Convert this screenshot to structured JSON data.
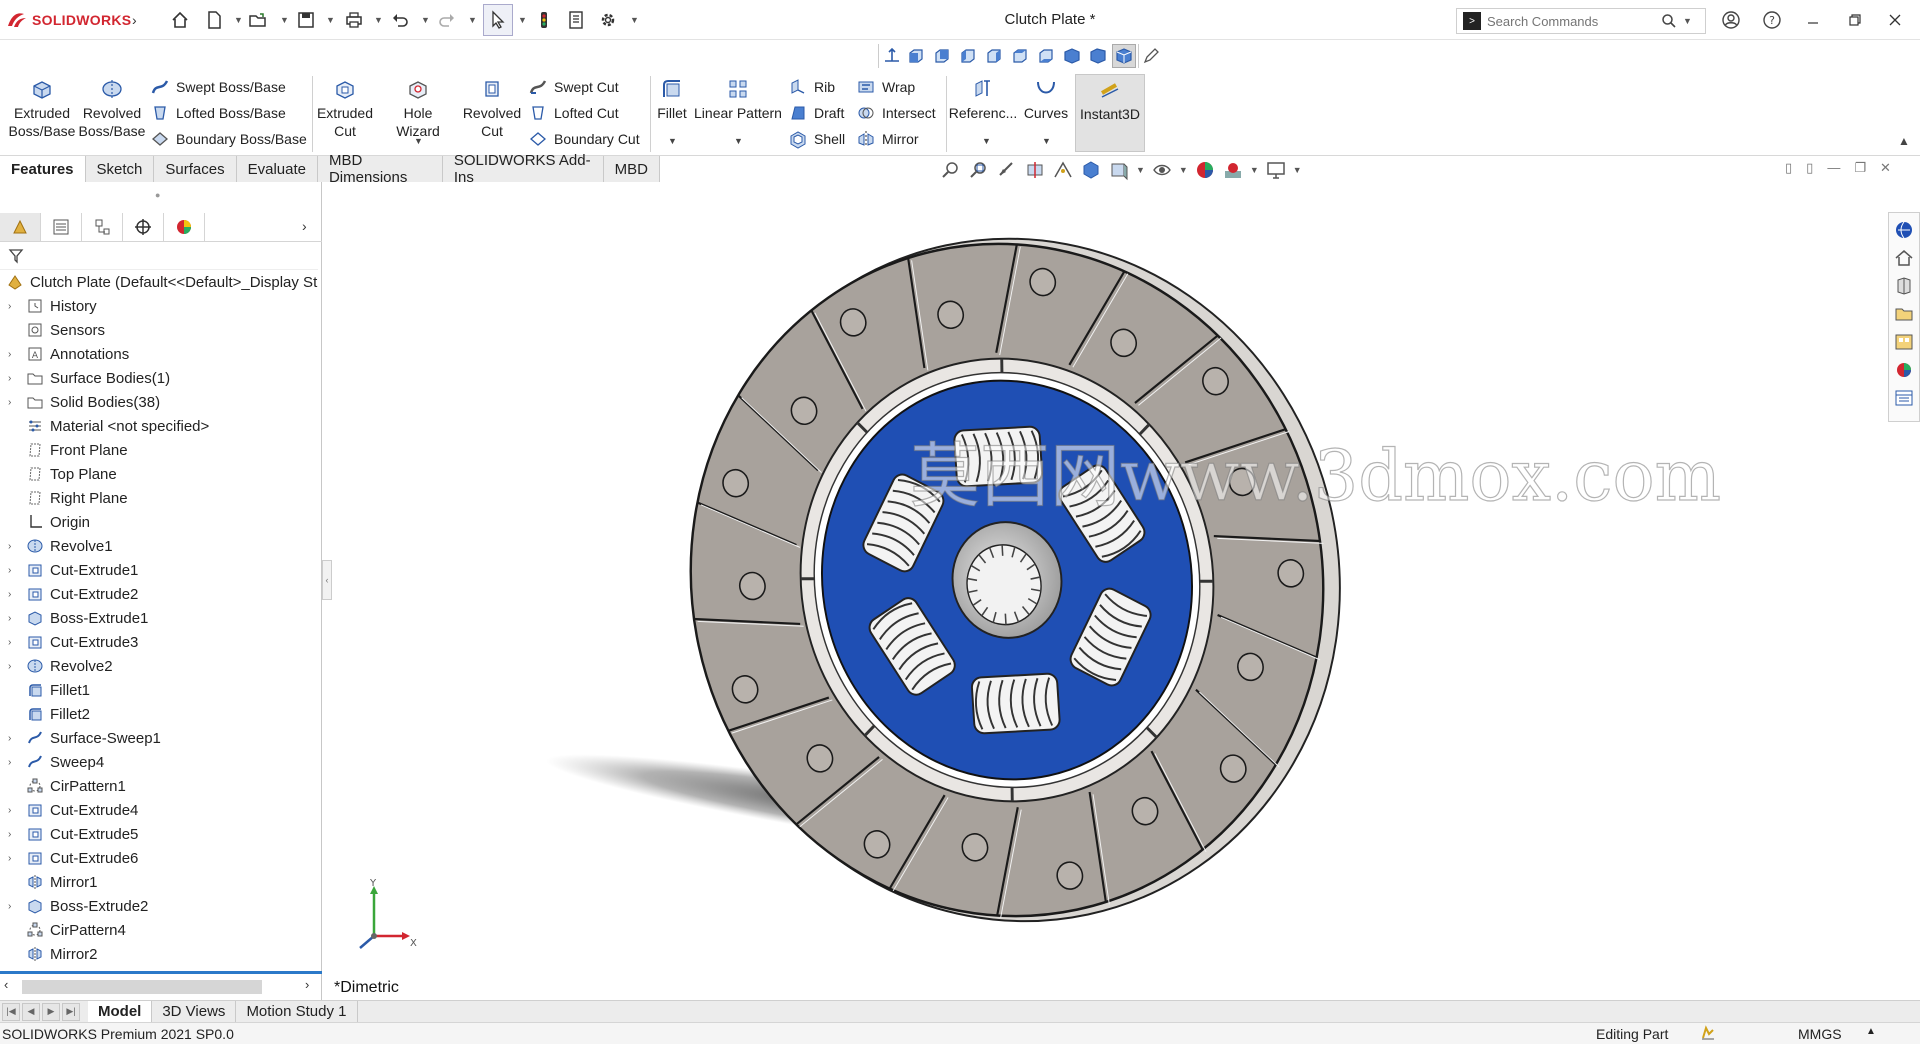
{
  "app": {
    "logo_text": "SOLIDWORKS",
    "document_title": "Clutch Plate *",
    "search": {
      "placeholder": "Search Commands"
    }
  },
  "ribbon": {
    "extruded_boss": "Extruded\nBoss/Base",
    "revolved_boss": "Revolved\nBoss/Base",
    "swept_boss": "Swept Boss/Base",
    "lofted_boss": "Lofted Boss/Base",
    "boundary_boss": "Boundary Boss/Base",
    "extruded_cut": "Extruded\nCut",
    "hole_wizard": "Hole Wizard",
    "revolved_cut": "Revolved\nCut",
    "swept_cut": "Swept Cut",
    "lofted_cut": "Lofted Cut",
    "boundary_cut": "Boundary Cut",
    "fillet": "Fillet",
    "linear_pattern": "Linear Pattern",
    "rib": "Rib",
    "draft": "Draft",
    "shell": "Shell",
    "wrap": "Wrap",
    "intersect": "Intersect",
    "mirror": "Mirror",
    "reference": "Referenc...",
    "curves": "Curves",
    "instant3d": "Instant3D"
  },
  "tabs": [
    "Features",
    "Sketch",
    "Surfaces",
    "Evaluate",
    "MBD Dimensions",
    "SOLIDWORKS Add-Ins",
    "MBD"
  ],
  "tree": {
    "root": "Clutch Plate  (Default<<Default>_Display St",
    "items": [
      {
        "label": "History",
        "icon": "history-icon",
        "exp": true
      },
      {
        "label": "Sensors",
        "icon": "sensor-icon",
        "exp": false
      },
      {
        "label": "Annotations",
        "icon": "annotation-icon",
        "exp": true
      },
      {
        "label": "Surface Bodies(1)",
        "icon": "folder-icon",
        "exp": true
      },
      {
        "label": "Solid Bodies(38)",
        "icon": "folder-icon",
        "exp": true
      },
      {
        "label": "Material <not specified>",
        "icon": "material-icon",
        "exp": false
      },
      {
        "label": "Front Plane",
        "icon": "plane-icon",
        "exp": false
      },
      {
        "label": "Top Plane",
        "icon": "plane-icon",
        "exp": false
      },
      {
        "label": "Right Plane",
        "icon": "plane-icon",
        "exp": false
      },
      {
        "label": "Origin",
        "icon": "origin-icon",
        "exp": false
      },
      {
        "label": "Revolve1",
        "icon": "revolve-icon",
        "exp": true
      },
      {
        "label": "Cut-Extrude1",
        "icon": "cut-extrude-icon",
        "exp": true
      },
      {
        "label": "Cut-Extrude2",
        "icon": "cut-extrude-icon",
        "exp": true
      },
      {
        "label": "Boss-Extrude1",
        "icon": "boss-extrude-icon",
        "exp": true
      },
      {
        "label": "Cut-Extrude3",
        "icon": "cut-extrude-icon",
        "exp": true
      },
      {
        "label": "Revolve2",
        "icon": "revolve-icon",
        "exp": true
      },
      {
        "label": "Fillet1",
        "icon": "fillet-icon",
        "exp": false
      },
      {
        "label": "Fillet2",
        "icon": "fillet-icon",
        "exp": false
      },
      {
        "label": "Surface-Sweep1",
        "icon": "sweep-icon",
        "exp": true
      },
      {
        "label": "Sweep4",
        "icon": "sweep-icon",
        "exp": true
      },
      {
        "label": "CirPattern1",
        "icon": "pattern-icon",
        "exp": false
      },
      {
        "label": "Cut-Extrude4",
        "icon": "cut-extrude-icon",
        "exp": true
      },
      {
        "label": "Cut-Extrude5",
        "icon": "cut-extrude-icon",
        "exp": true
      },
      {
        "label": "Cut-Extrude6",
        "icon": "cut-extrude-icon",
        "exp": true
      },
      {
        "label": "Mirror1",
        "icon": "mirror-icon",
        "exp": false
      },
      {
        "label": "Boss-Extrude2",
        "icon": "boss-extrude-icon",
        "exp": true
      },
      {
        "label": "CirPattern4",
        "icon": "pattern-icon",
        "exp": false
      },
      {
        "label": "Mirror2",
        "icon": "mirror-icon",
        "exp": false
      }
    ]
  },
  "graphics": {
    "view_name": "*Dimetric",
    "watermark": "莫西网www.3dmox.com",
    "triad_x": "X",
    "triad_y": "Y"
  },
  "bottom_tabs": [
    "Model",
    "3D Views",
    "Motion Study 1"
  ],
  "status": {
    "product": "SOLIDWORKS Premium 2021 SP0.0",
    "mode": "Editing Part",
    "units": "MMGS"
  },
  "colors": {
    "accent": "#2b79c9",
    "hub_blue": "#1f4fb4",
    "brand_red": "#d22630",
    "friction_grey": "#a8a29c"
  }
}
